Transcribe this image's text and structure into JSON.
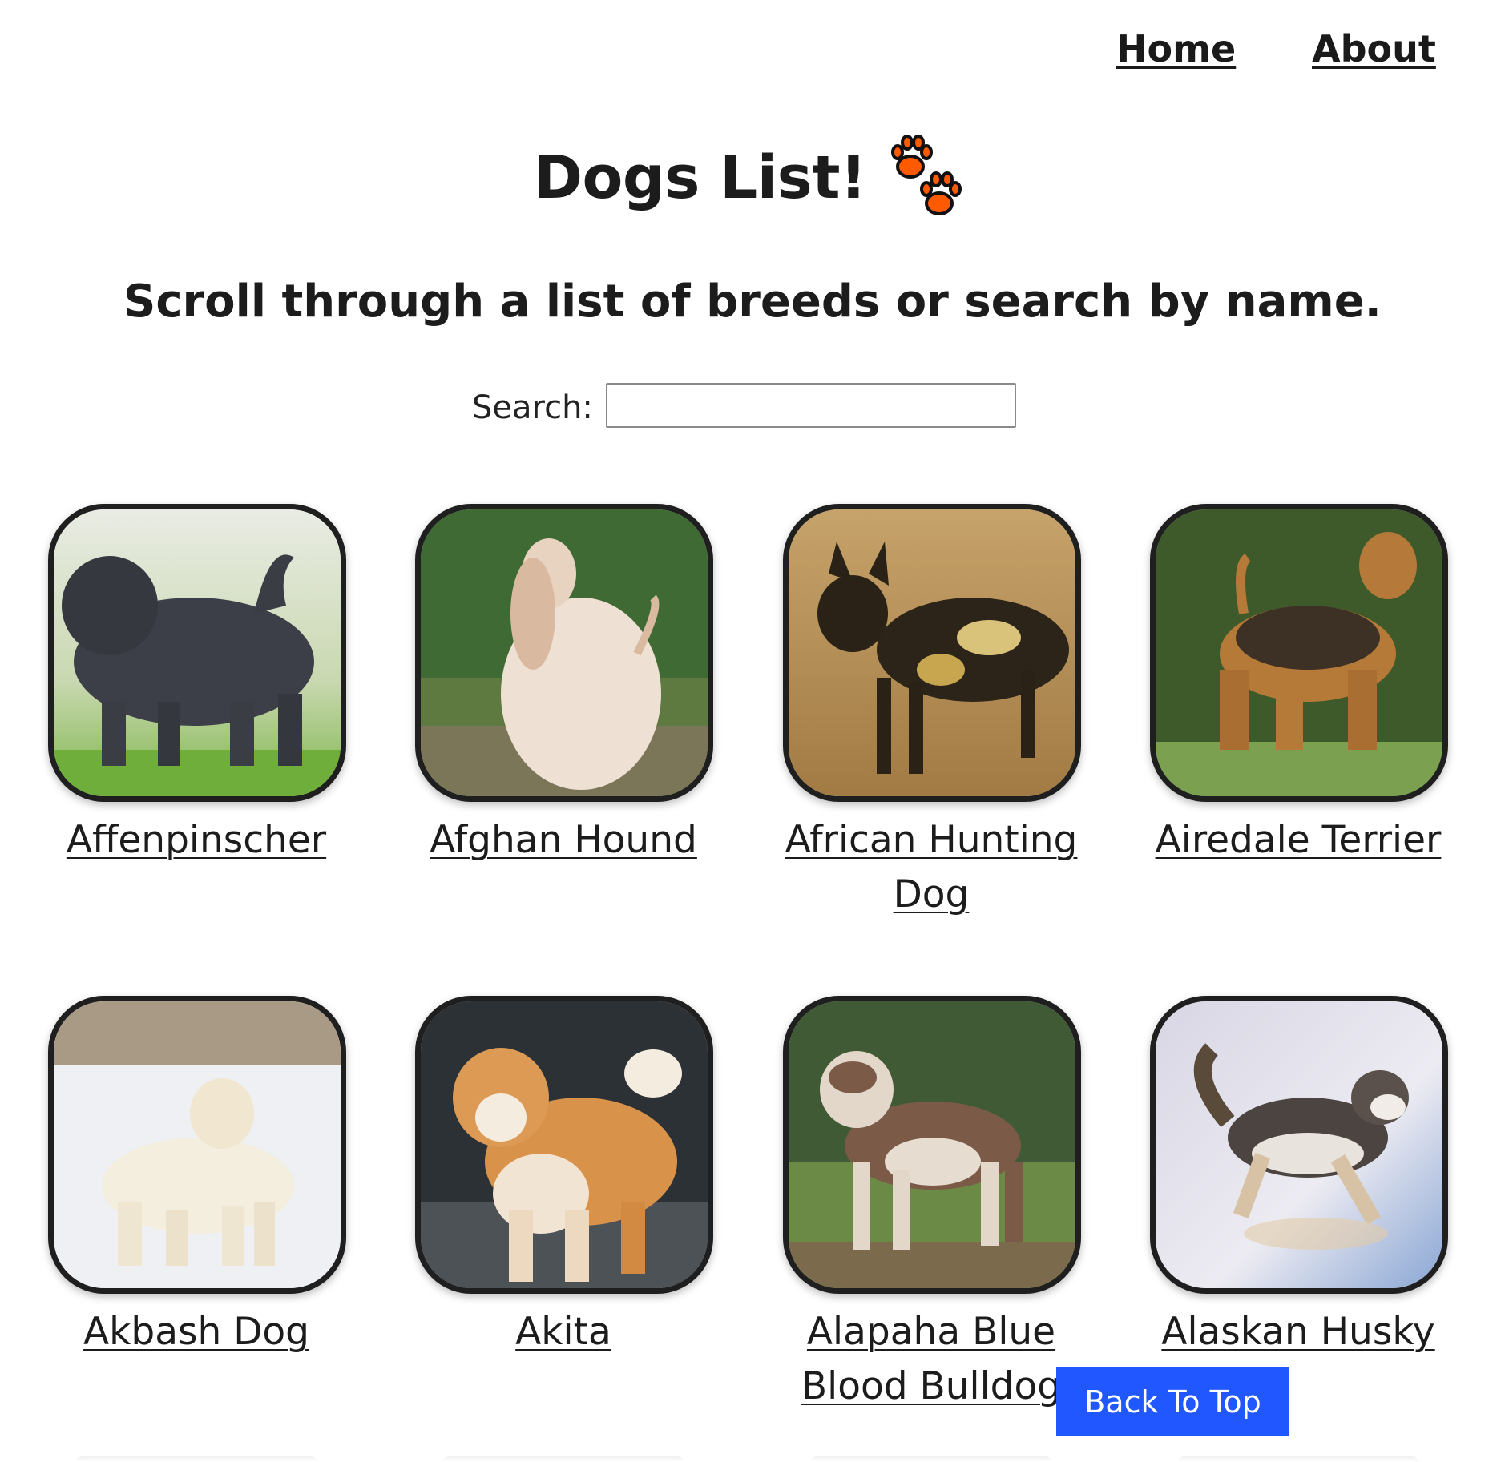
{
  "nav": {
    "home_label": "Home",
    "about_label": "About"
  },
  "header": {
    "title": "Dogs List!",
    "paw_icon": "paw-prints-icon",
    "subtitle": "Scroll through a list of breeds or search by name."
  },
  "search": {
    "label": "Search:",
    "value": "",
    "placeholder": ""
  },
  "breeds": [
    {
      "name": "Affenpinscher",
      "image": "affenpinscher-photo"
    },
    {
      "name": "Afghan Hound",
      "image": "afghan-hound-photo"
    },
    {
      "name": "African Hunting Dog",
      "image": "african-hunting-dog-photo"
    },
    {
      "name": "Airedale Terrier",
      "image": "airedale-terrier-photo"
    },
    {
      "name": "Akbash Dog",
      "image": "akbash-dog-photo"
    },
    {
      "name": "Akita",
      "image": "akita-photo"
    },
    {
      "name": "Alapaha Blue Blood Bulldog",
      "image": "alapaha-blue-blood-bulldog-photo"
    },
    {
      "name": "Alaskan Husky",
      "image": "alaskan-husky-photo"
    }
  ],
  "back_to_top": {
    "label": "Back To Top"
  },
  "colors": {
    "accent": "#2157ff",
    "paw": "#ff5a00",
    "frame": "#1f1f1f"
  }
}
